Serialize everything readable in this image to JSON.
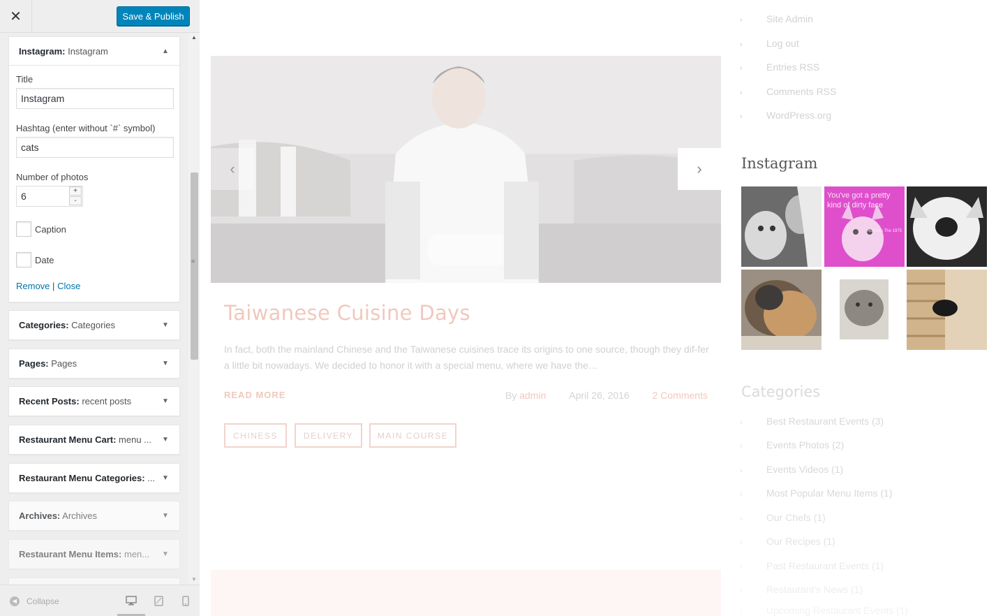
{
  "header": {
    "close_icon": "close-icon",
    "publish_label": "Save & Publish"
  },
  "instagram_widget": {
    "title_bold": "Instagram:",
    "title_sub": " Instagram",
    "title_label": "Title",
    "title_value": "Instagram",
    "hashtag_label": "Hashtag (enter without `#` symbol)",
    "hashtag_value": "cats",
    "photos_label": "Number of photos",
    "photos_value": "6",
    "spin_up": "+",
    "spin_down": "-",
    "caption_label": "Caption",
    "date_label": "Date",
    "remove_label": "Remove",
    "separator": "|",
    "close_label": "Close"
  },
  "widgets": [
    {
      "bold": "Categories:",
      "sub": " Categories"
    },
    {
      "bold": "Pages:",
      "sub": " Pages"
    },
    {
      "bold": "Recent Posts:",
      "sub": " recent posts"
    },
    {
      "bold": "Restaurant Menu Cart:",
      "sub": " menu ..."
    },
    {
      "bold": "Restaurant Menu Categories:",
      "sub": " ..."
    },
    {
      "bold": "Archives:",
      "sub": " Archives"
    },
    {
      "bold": "Restaurant Menu Items:",
      "sub": " men..."
    }
  ],
  "footer": {
    "collapse_label": "Collapse"
  },
  "preview": {
    "post_title": "Taiwanese Cuisine Days",
    "post_excerpt": "In fact, both the mainland Chinese and the Taiwanese cuisines trace its origins to one source, though they dif-fer a little bit nowadays. We decided to honor it with a special menu, where we have the…",
    "read_more": "READ MORE",
    "by": "By",
    "author": "admin",
    "date": "April 26, 2016",
    "comments": "2 Comments",
    "tags": [
      "CHINESS",
      "DELIVERY",
      "MAIN COURSE"
    ],
    "meta_links": [
      "Site Admin",
      "Log out",
      "Entries RSS",
      "Comments RSS",
      "WordPress.org"
    ],
    "instagram_heading": "Instagram",
    "insta_overlay_text": "You've got a pretty kind of dirty face",
    "insta_overlay_credit": "Robbers The 1975",
    "categories_heading": "Categories",
    "categories": [
      "Best Restaurant Events (3)",
      "Events Photos (2)",
      "Events Videos (1)",
      "Most Popular Menu Items (1)",
      "Our Chefs (1)",
      "Our Recipes (1)",
      "Past Restaurant Events (1)",
      "Restaurant's News (1)",
      "Upcoming Restaurant Events (1)"
    ]
  },
  "colors": {
    "primary_button": "#0085ba",
    "link": "#0073aa",
    "accent": "#f0c8be"
  }
}
